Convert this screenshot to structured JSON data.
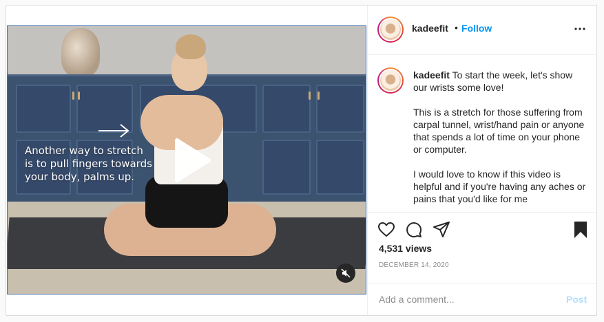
{
  "post": {
    "author": {
      "username": "kadeefit",
      "follow_label": "Follow",
      "separator": "•"
    },
    "video": {
      "overlay_text": "Another way to stretch is to pull fingers towards your body, palms up.",
      "play_icon": "play-icon",
      "mute_icon": "volume-muted-icon"
    },
    "caption": {
      "username": "kadeefit",
      "paragraphs": [
        "To start the week, let's show our wrists some love!",
        "This is a stretch for those suffering from carpal tunnel, wrist/hand pain or anyone that spends a lot of time on your phone or computer.",
        "I would love to know if this video is helpful and if you're having any aches or pains that you'd like for me"
      ]
    },
    "actions": {
      "like_icon": "heart-icon",
      "comment_icon": "comment-icon",
      "share_icon": "paper-plane-icon",
      "save_icon": "bookmark-icon"
    },
    "views": "4,531 views",
    "date": "DECEMBER 14, 2020",
    "comment": {
      "placeholder": "Add a comment...",
      "post_label": "Post"
    }
  },
  "colors": {
    "accent": "#0095f6",
    "post_disabled": "#b2dffc",
    "muted_text": "#8e8e8e",
    "border": "#dbdbdb"
  }
}
